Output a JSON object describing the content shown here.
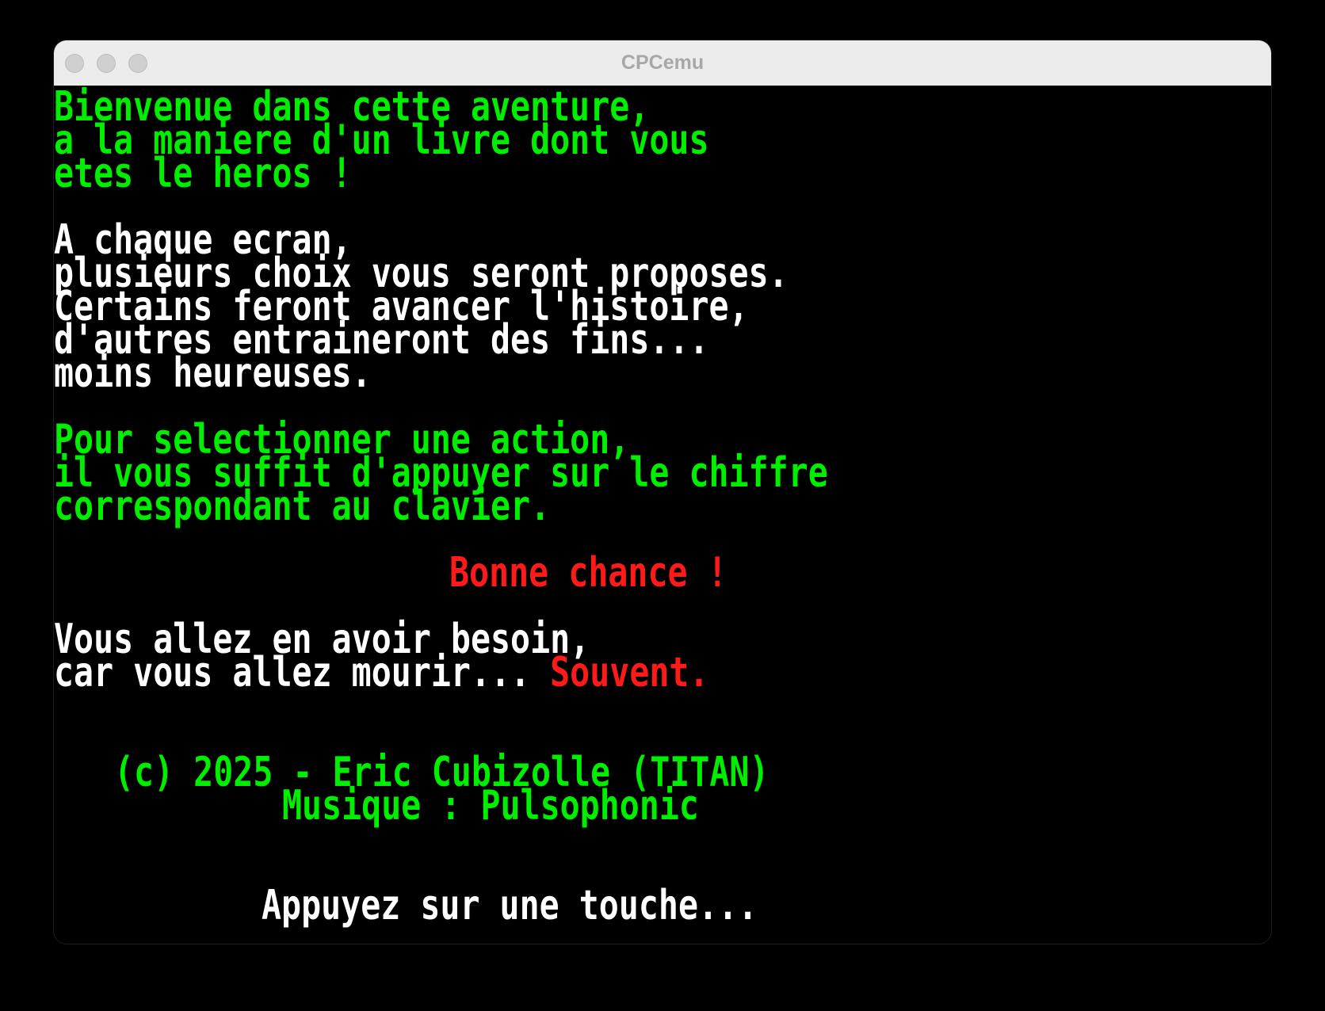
{
  "window": {
    "title": "CPCemu"
  },
  "screen": {
    "intro": [
      "Bienvenue dans cette aventure,",
      "a la maniere d'un livre dont vous",
      "etes le heros !"
    ],
    "rules": [
      "A chaque ecran,",
      "plusieurs choix vous seront proposes.",
      "Certains feront avancer l'histoire,",
      "d'autres entraineront des fins...",
      "moins heureuses."
    ],
    "instructions": [
      "Pour selectionner une action,",
      "il vous suffit d'appuyer sur le chiffre",
      "correspondant au clavier."
    ],
    "good_luck": "Bonne chance !",
    "warning_line1": "Vous allez en avoir besoin,",
    "warning_line2_prefix": "car vous allez mourir... ",
    "warning_line2_emphasis": "Souvent.",
    "credits": [
      "(c) 2025 - Eric Cubizolle (TITAN)",
      "Musique : Pulsophonic"
    ],
    "prompt": "Appuyez sur une touche..."
  },
  "colors": {
    "screen_background": "#000000",
    "text_green": "#00ee00",
    "text_white": "#ffffff",
    "text_red": "#ff1a1a",
    "titlebar": "#ececec"
  }
}
